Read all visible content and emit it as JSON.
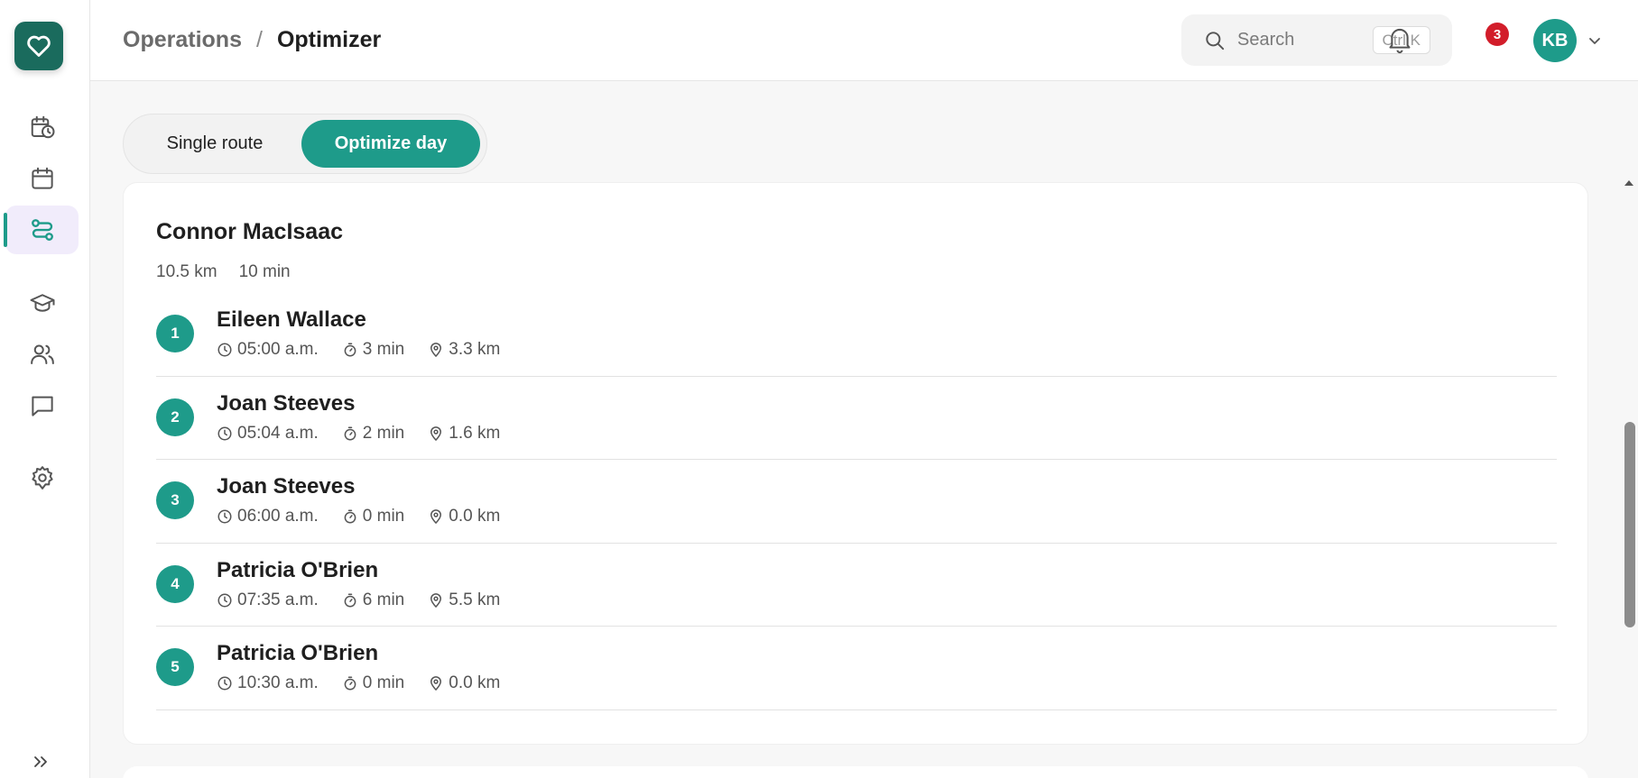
{
  "header": {
    "breadcrumb_parent": "Operations",
    "breadcrumb_separator": "/",
    "breadcrumb_current": "Optimizer",
    "search_placeholder": "Search",
    "search_shortcut": "Ctrl K",
    "notification_count": "3",
    "avatar_initials": "KB"
  },
  "sidebar": {
    "items": [
      {
        "name": "schedule-icon"
      },
      {
        "name": "calendar-icon"
      },
      {
        "name": "route-icon",
        "active": true
      },
      {
        "name": "graduation-cap-icon"
      },
      {
        "name": "users-icon"
      },
      {
        "name": "chat-icon"
      },
      {
        "name": "gear-icon"
      }
    ]
  },
  "mode_toggle": {
    "single_label": "Single route",
    "day_label": "Optimize day",
    "selected": "Optimize day"
  },
  "route": {
    "driver": "Connor MacIsaac",
    "distance": "10.5 km",
    "duration": "10 min",
    "stops": [
      {
        "num": "1",
        "name": "Eileen Wallace",
        "time": "05:00 a.m.",
        "drive": "3 min",
        "dist": "3.3 km"
      },
      {
        "num": "2",
        "name": "Joan Steeves",
        "time": "05:04 a.m.",
        "drive": "2 min",
        "dist": "1.6 km"
      },
      {
        "num": "3",
        "name": "Joan Steeves",
        "time": "06:00 a.m.",
        "drive": "0 min",
        "dist": "0.0 km"
      },
      {
        "num": "4",
        "name": "Patricia O'Brien",
        "time": "07:35 a.m.",
        "drive": "6 min",
        "dist": "5.5 km"
      },
      {
        "num": "5",
        "name": "Patricia O'Brien",
        "time": "10:30 a.m.",
        "drive": "0 min",
        "dist": "0.0 km"
      }
    ]
  },
  "colors": {
    "accent": "#1e9b8a",
    "logo": "#1a6b5d",
    "badge": "#d21d2a"
  }
}
